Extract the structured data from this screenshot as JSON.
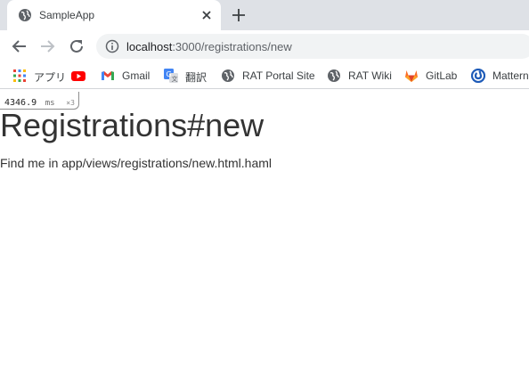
{
  "tab": {
    "title": "SampleApp"
  },
  "address_bar": {
    "host": "localhost",
    "path": ":3000/registrations/new"
  },
  "bookmarks": [
    {
      "label": "アプリ",
      "icon": "apps-grid-icon"
    },
    {
      "label": "",
      "icon": "youtube-icon"
    },
    {
      "label": "Gmail",
      "icon": "gmail-icon"
    },
    {
      "label": "翻訳",
      "icon": "google-translate-icon"
    },
    {
      "label": "RAT Portal Site",
      "icon": "globe-icon"
    },
    {
      "label": "RAT Wiki",
      "icon": "globe-icon"
    },
    {
      "label": "GitLab",
      "icon": "gitlab-icon"
    },
    {
      "label": "Mattern",
      "icon": "mattermost-icon"
    }
  ],
  "profiler": {
    "time": "4346.9",
    "unit": "ms",
    "count": "×3"
  },
  "page": {
    "title": "Registrations#new",
    "text": "Find me in app/views/registrations/new.html.haml"
  },
  "colors": {
    "tabstrip": "#dee1e6",
    "omnibox": "#f1f3f4",
    "text": "#333333"
  }
}
